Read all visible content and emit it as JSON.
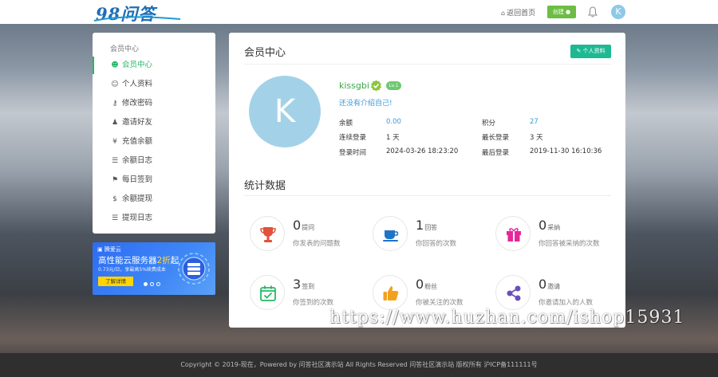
{
  "header": {
    "logo_text": "98问答",
    "home_link": "返回首页",
    "create_button": "创建",
    "avatar_letter": "K"
  },
  "sidebar": {
    "heading": "会员中心",
    "items": [
      {
        "label": "会员中心",
        "icon": "user-circle-icon"
      },
      {
        "label": "个人资料",
        "icon": "user-icon"
      },
      {
        "label": "修改密码",
        "icon": "key-icon"
      },
      {
        "label": "邀请好友",
        "icon": "users-icon"
      },
      {
        "label": "充值余额",
        "icon": "yen-icon"
      },
      {
        "label": "余额日志",
        "icon": "list-icon"
      },
      {
        "label": "每日签到",
        "icon": "signpost-icon"
      },
      {
        "label": "余额提现",
        "icon": "dollar-icon"
      },
      {
        "label": "提现日志",
        "icon": "list-icon"
      }
    ]
  },
  "ad": {
    "brand": "腾爱云",
    "title_pre": "高性能云服务器",
    "title_highlight": "2折",
    "title_post": "起",
    "subtitle": "0.73元/日，享最高5%续费成本",
    "button": "了解详情"
  },
  "main": {
    "title": "会员中心",
    "profile_button": "个人资料",
    "avatar_letter": "K",
    "username": "kissgbi",
    "level": "Lv.1",
    "bio": "还没有介绍自己!",
    "stats": [
      {
        "label": "余额",
        "value": "0.00",
        "blue": true
      },
      {
        "label": "积分",
        "value": "27",
        "blue": true
      },
      {
        "label": "连续登录",
        "value": "1 天",
        "blue": false
      },
      {
        "label": "最长登录",
        "value": "3 天",
        "blue": false
      },
      {
        "label": "登录时间",
        "value": "2024-03-26 18:23:20",
        "blue": false
      },
      {
        "label": "最后登录",
        "value": "2019-11-30 16:10:36",
        "blue": false
      }
    ],
    "section_title": "统计数据",
    "cards": [
      {
        "num": "0",
        "unit": "提问",
        "desc": "你发表的问题数",
        "icon": "trophy-icon",
        "color": "#e0523b"
      },
      {
        "num": "1",
        "unit": "回答",
        "desc": "你回答的次数",
        "icon": "cup-icon",
        "color": "#1e73c9"
      },
      {
        "num": "0",
        "unit": "采纳",
        "desc": "你回答被采纳的次数",
        "icon": "gift-icon",
        "color": "#e6279b"
      },
      {
        "num": "3",
        "unit": "签到",
        "desc": "你签到的次数",
        "icon": "calendar-check-icon",
        "color": "#25b864"
      },
      {
        "num": "0",
        "unit": "粉丝",
        "desc": "你被关注的次数",
        "icon": "thumbs-up-icon",
        "color": "#f0a21f"
      },
      {
        "num": "0",
        "unit": "邀请",
        "desc": "你邀请加入的人数",
        "icon": "share-icon",
        "color": "#6b4fbb"
      }
    ]
  },
  "watermark": "https://www.huzhan.com/ishop15931",
  "footer": "Copyright © 2019-现在，Powered by 问答社区演示站 All Rights Reserved 问答社区演示站 版权所有 沪ICP备111111号"
}
